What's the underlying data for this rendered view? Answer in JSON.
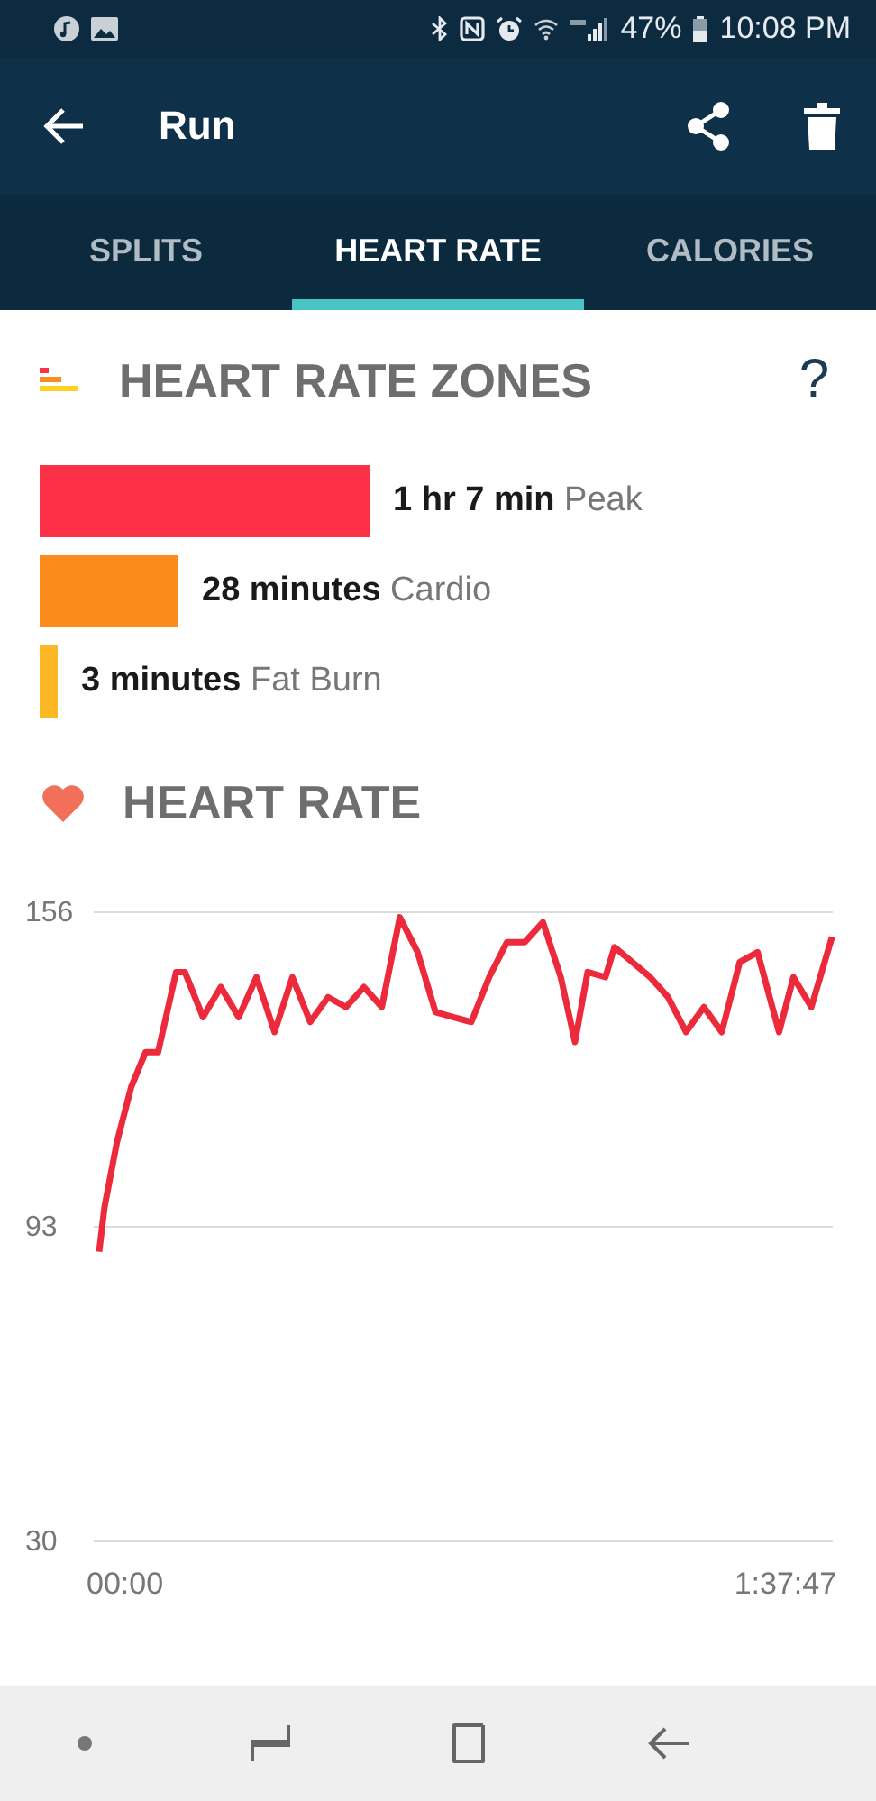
{
  "status_bar": {
    "battery": "47%",
    "time": "10:08 PM"
  },
  "app_bar": {
    "title": "Run"
  },
  "tabs": [
    {
      "label": "SPLITS",
      "selected": false
    },
    {
      "label": "HEART RATE",
      "selected": true
    },
    {
      "label": "CALORIES",
      "selected": false
    }
  ],
  "zones_section": {
    "title": "HEART RATE ZONES",
    "help": "?",
    "zones": [
      {
        "duration": "1 hr 7 min",
        "name": "Peak",
        "color": "#fc3148"
      },
      {
        "duration": "28 minutes",
        "name": "Cardio",
        "color": "#fb8c1c"
      },
      {
        "duration": "3 minutes",
        "name": "Fat Burn",
        "color": "#fbb724"
      }
    ]
  },
  "heart_rate_section": {
    "title": "HEART RATE",
    "chart_data": {
      "type": "line",
      "x": [
        -3.81,
        -3.02,
        -1.17,
        0.95,
        3.07,
        4.93,
        7.58,
        8.9,
        11.55,
        14.2,
        16.85,
        19.5,
        22.15,
        24.79,
        27.44,
        30.09,
        32.74,
        35.39,
        38.04,
        40.69,
        43.34,
        45.99,
        48.64,
        51.29,
        53.93,
        56.58,
        59.23,
        61.88,
        64.53,
        66.65,
        68.5,
        71.15,
        72.48,
        75.13,
        77.77,
        80.42,
        83.07,
        85.72,
        88.37,
        91.02,
        93.67,
        96.85,
        98.97,
        101.62,
        104.7
      ],
      "series": [
        {
          "color": "#ec2a3c",
          "values": [
            88,
            97,
            110,
            121,
            128,
            128,
            144,
            144,
            135,
            141,
            135,
            143,
            132,
            143,
            134,
            139,
            137,
            141,
            137,
            155,
            148,
            136,
            135,
            134,
            143,
            150,
            150,
            154,
            143,
            130,
            144,
            143,
            149,
            146,
            143,
            139,
            132,
            137,
            132,
            146,
            148,
            132,
            143,
            137,
            151
          ]
        }
      ],
      "xlim": [
        -4.61,
        104.8
      ],
      "ylim": [
        30,
        156
      ],
      "xticks": [
        {
          "value": 0,
          "label": "00:00"
        },
        {
          "value": 97.78,
          "label": "1:37:47"
        }
      ],
      "yticks": [
        30,
        93,
        156
      ]
    }
  }
}
